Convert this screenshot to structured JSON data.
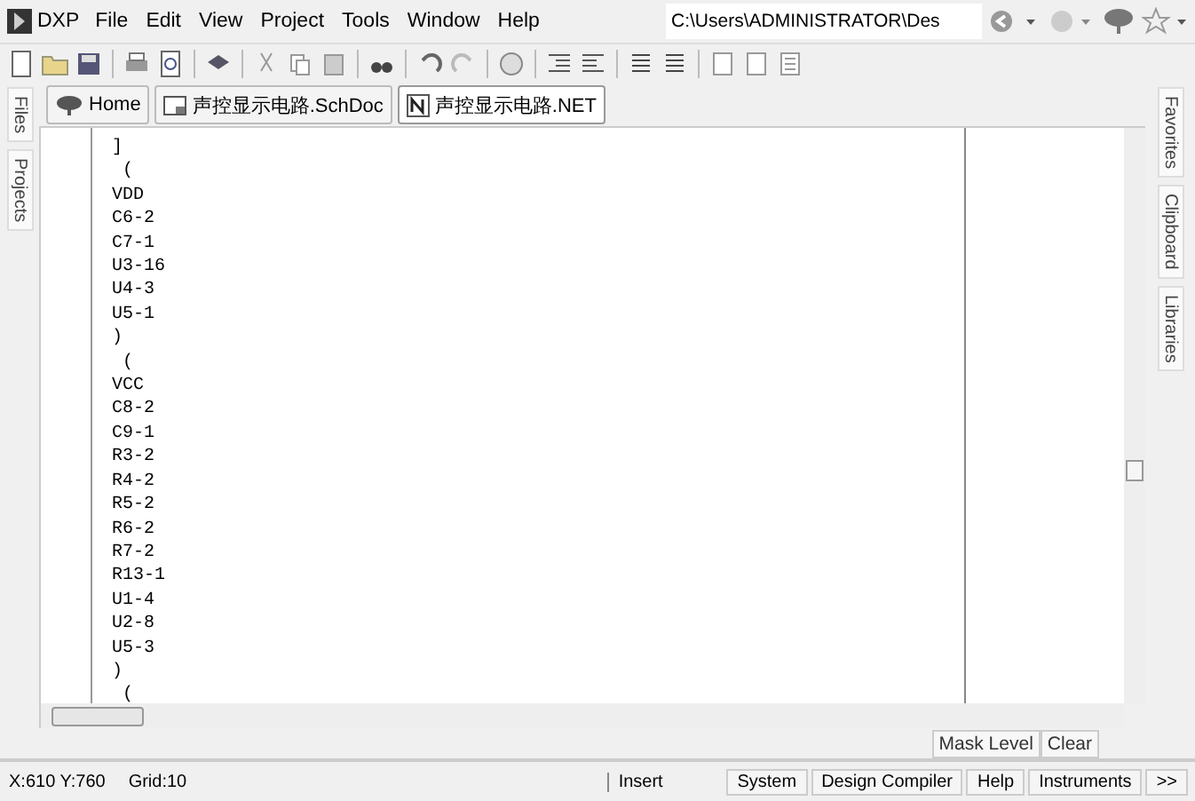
{
  "menu_bar": {
    "app": "DXP",
    "items": [
      "File",
      "Edit",
      "View",
      "Project",
      "Tools",
      "Window",
      "Help"
    ],
    "path_field": {
      "value": "C:\\Users\\ADMINISTRATOR\\Des"
    }
  },
  "left_panel_tabs": [
    {
      "label": "Files"
    },
    {
      "label": "Projects"
    }
  ],
  "right_panel_tabs": [
    {
      "label": "Favorites"
    },
    {
      "label": "Clipboard"
    },
    {
      "label": "Libraries"
    }
  ],
  "document_tabs": [
    {
      "kind": "home",
      "label": "Home",
      "selected": false
    },
    {
      "kind": "schematic",
      "label": "声控显示电路.SchDoc",
      "selected": false
    },
    {
      "kind": "netlist",
      "label": "声控显示电路.NET",
      "selected": true
    }
  ],
  "editor": {
    "lines": [
      "]",
      " (",
      "VDD",
      "C6-2",
      "C7-1",
      "U3-16",
      "U4-3",
      "U5-1",
      ")",
      " (",
      "VCC",
      "C8-2",
      "C9-1",
      "R3-2",
      "R4-2",
      "R5-2",
      "R6-2",
      "R7-2",
      "R13-1",
      "U1-4",
      "U2-8",
      "U5-3",
      ")",
      " ("
    ]
  },
  "mask_bar": {
    "buttons": [
      "Mask Level",
      "Clear"
    ]
  },
  "status_bar": {
    "coords": "X:610 Y:760",
    "grid": "Grid:10",
    "mode": "Insert",
    "buttons": [
      "System",
      "Design Compiler",
      "Help",
      "Instruments",
      ">>"
    ]
  }
}
